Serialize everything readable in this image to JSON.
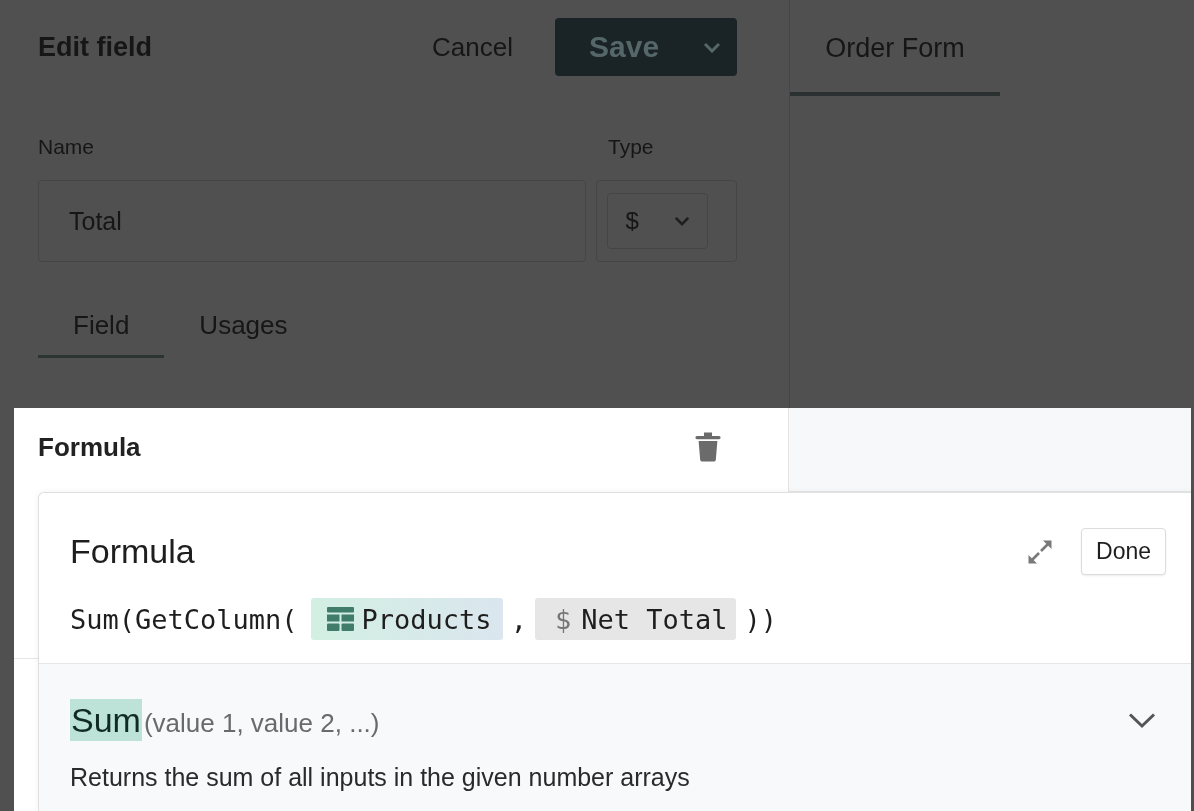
{
  "background": {
    "title": "Edit field",
    "cancel": "Cancel",
    "save": "Save",
    "fields": [
      {
        "kind": "text",
        "label": "Name",
        "value": "Total"
      },
      {
        "kind": "select",
        "label": "Type",
        "value": "$"
      }
    ],
    "tabs": [
      {
        "label": "Field",
        "selected": true
      },
      {
        "label": "Usages",
        "selected": false
      }
    ],
    "side_tabs": [
      {
        "label": "Order Form",
        "selected": true
      }
    ]
  },
  "formula_panel": {
    "title": "Formula"
  },
  "editor": {
    "title": "Formula",
    "done": "Done",
    "expression": [
      {
        "kind": "text",
        "text": "Sum(GetColumn("
      },
      {
        "kind": "table",
        "text": "Products"
      },
      {
        "kind": "text",
        "text": ","
      },
      {
        "kind": "column",
        "symbol": "$",
        "text": "Net Total"
      },
      {
        "kind": "text",
        "text": "))"
      }
    ]
  },
  "help": {
    "function": "Sum",
    "signature": "(value 1, value 2, ...)",
    "description": "Returns the sum of all inputs in the given number arrays"
  }
}
